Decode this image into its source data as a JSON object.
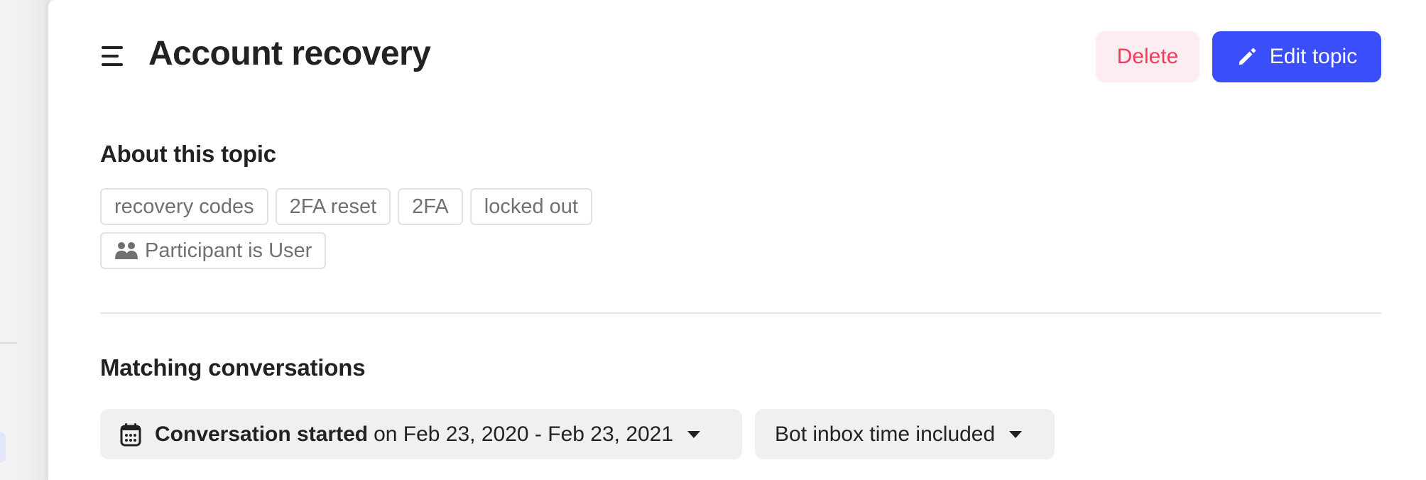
{
  "sidebar": {
    "active_item_color": "#e3e6fb"
  },
  "header": {
    "menu_icon": "hamburger-menu-icon",
    "title": "Account recovery",
    "delete_label": "Delete",
    "edit_label": "Edit topic",
    "edit_icon": "pencil-icon",
    "colors": {
      "delete_text": "#f43a5a",
      "delete_bg": "#feedf0",
      "primary": "#3a4ffb"
    }
  },
  "about": {
    "title": "About this topic",
    "keywords": [
      "recovery codes",
      "2FA reset",
      "2FA",
      "locked out"
    ],
    "participant_filter": {
      "icon": "people-icon",
      "label": "Participant is User"
    }
  },
  "matching": {
    "title": "Matching conversations",
    "date_filter": {
      "icon": "calendar-icon",
      "field_label": "Conversation started",
      "range_text": "on Feb 23, 2020 - Feb 23, 2021",
      "caret_icon": "caret-down-icon"
    },
    "bot_filter": {
      "label": "Bot inbox time included",
      "caret_icon": "caret-down-icon"
    }
  }
}
